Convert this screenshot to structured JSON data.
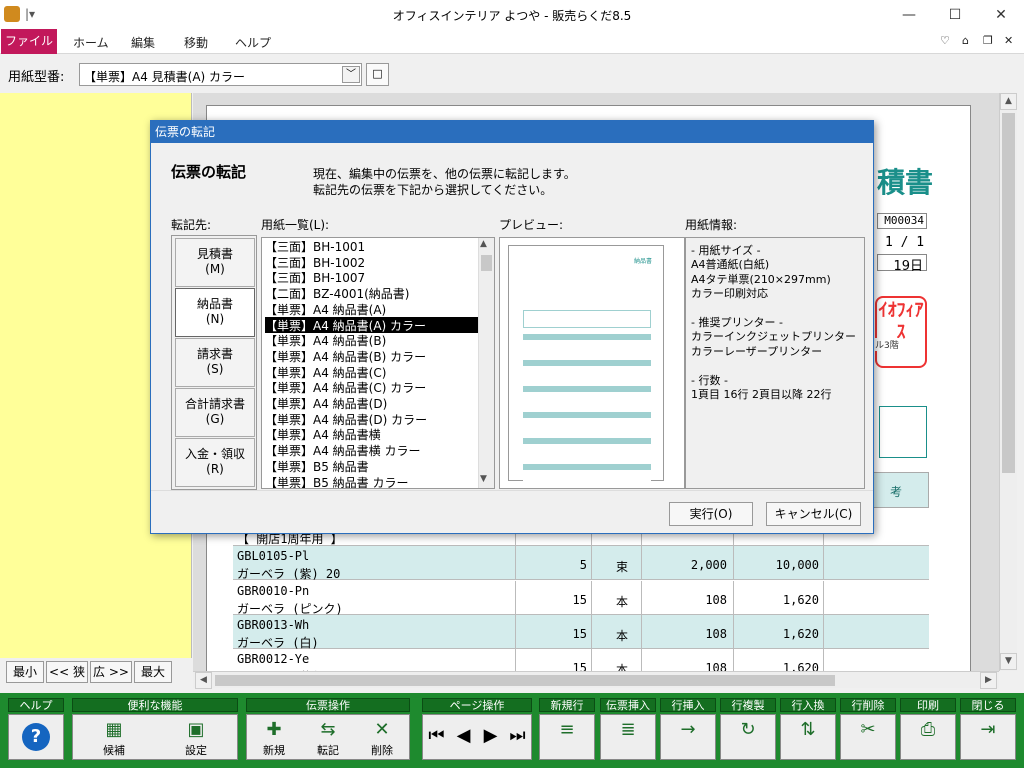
{
  "window": {
    "title": "オフィスインテリア よつや - 販売らくだ8.5"
  },
  "menu": {
    "file": "ファイル",
    "items": [
      "ホーム",
      "編集",
      "移動",
      "ヘルプ"
    ]
  },
  "toolbar": {
    "label": "用紙型番:",
    "select_value": "【単票】A4 見積書(A) カラー"
  },
  "paper": {
    "title": "積書",
    "docno": "M00034",
    "date1": "1 / 1",
    "date2": "19日",
    "stamp": "ｲｵﾌｨｱｽ",
    "stamp_small": "ル3階",
    "col_label": "考"
  },
  "rows": [
    {
      "code": "【 開店1周年用 】",
      "name": "",
      "qty": "",
      "unit": "",
      "price": "",
      "amount": ""
    },
    {
      "code": "GBL0105-Pl",
      "name": "ガーベラ (紫) 20",
      "qty": "5",
      "unit": "束",
      "price": "2,000",
      "amount": "10,000"
    },
    {
      "code": "GBR0010-Pn",
      "name": "ガーベラ (ピンク)",
      "qty": "15",
      "unit": "本",
      "price": "108",
      "amount": "1,620"
    },
    {
      "code": "GBR0013-Wh",
      "name": "ガーベラ (白)",
      "qty": "15",
      "unit": "本",
      "price": "108",
      "amount": "1,620"
    },
    {
      "code": "GBR0012-Ye",
      "name": "ガーベラ (黄色)",
      "qty": "15",
      "unit": "本",
      "price": "108",
      "amount": "1,620"
    }
  ],
  "zoom": {
    "min": "最小",
    "narrow": "<< 狭",
    "wide": "広 >>",
    "max": "最大"
  },
  "dialog": {
    "titlebar": "伝票の転記",
    "heading": "伝票の転記",
    "desc1": "現在、編集中の伝票を、他の伝票に転記します。",
    "desc2": "転記先の伝票を下記から選択してください。",
    "dest_label": "転記先:",
    "list_label": "用紙一覧(L):",
    "preview_label": "プレビュー:",
    "info_label": "用紙情報:",
    "dest_buttons": [
      {
        "name": "見積書",
        "key": "(M)"
      },
      {
        "name": "納品書",
        "key": "(N)"
      },
      {
        "name": "請求書",
        "key": "(S)"
      },
      {
        "name": "合計請求書",
        "key": "(G)"
      },
      {
        "name": "入金・領収",
        "key": "(R)"
      }
    ],
    "list": [
      "【三面】BH-1001",
      "【三面】BH-1002",
      "【三面】BH-1007",
      "【二面】BZ-4001(納品書)",
      "【単票】A4 納品書(A)",
      "【単票】A4 納品書(A) カラー",
      "【単票】A4 納品書(B)",
      "【単票】A4 納品書(B) カラー",
      "【単票】A4 納品書(C)",
      "【単票】A4 納品書(C) カラー",
      "【単票】A4 納品書(D)",
      "【単票】A4 納品書(D) カラー",
      "【単票】A4 納品書横",
      "【単票】A4 納品書横 カラー",
      "【単票】B5 納品書",
      "【単票】B5 納品書 カラー"
    ],
    "selected_index": 5,
    "preview_title": "納品書",
    "info": [
      "- 用紙サイズ -",
      "A4普通紙(白紙)",
      "A4タテ単票(210×297mm)",
      "カラー印刷対応",
      "",
      "- 推奨プリンター -",
      "カラーインクジェットプリンター",
      "カラーレーザープリンター",
      "",
      "- 行数 -",
      "1頁目 16行 2頁目以降 22行"
    ],
    "ok": "実行(O)",
    "cancel": "キャンセル(C)"
  },
  "bottom": {
    "groups": [
      {
        "label": "ヘルプ",
        "buttons": [
          ""
        ]
      },
      {
        "label": "便利な機能",
        "buttons": [
          "候補",
          "設定"
        ]
      },
      {
        "label": "伝票操作",
        "buttons": [
          "新規",
          "転記",
          "削除"
        ]
      },
      {
        "label": "ページ操作",
        "buttons": [
          "",
          "",
          "",
          ""
        ]
      },
      {
        "label": "新規行",
        "buttons": [
          ""
        ]
      },
      {
        "label": "伝票挿入",
        "buttons": [
          ""
        ]
      },
      {
        "label": "行挿入",
        "buttons": [
          ""
        ]
      },
      {
        "label": "行複製",
        "buttons": [
          ""
        ]
      },
      {
        "label": "行入換",
        "buttons": [
          ""
        ]
      },
      {
        "label": "行削除",
        "buttons": [
          ""
        ]
      },
      {
        "label": "印刷",
        "buttons": [
          ""
        ]
      },
      {
        "label": "閉じる",
        "buttons": [
          ""
        ]
      }
    ]
  },
  "colors": {
    "accent": "#c2185b",
    "bar": "#1e8a2e",
    "teal": "#d4ecec",
    "dialog_title": "#2a6ebd"
  }
}
